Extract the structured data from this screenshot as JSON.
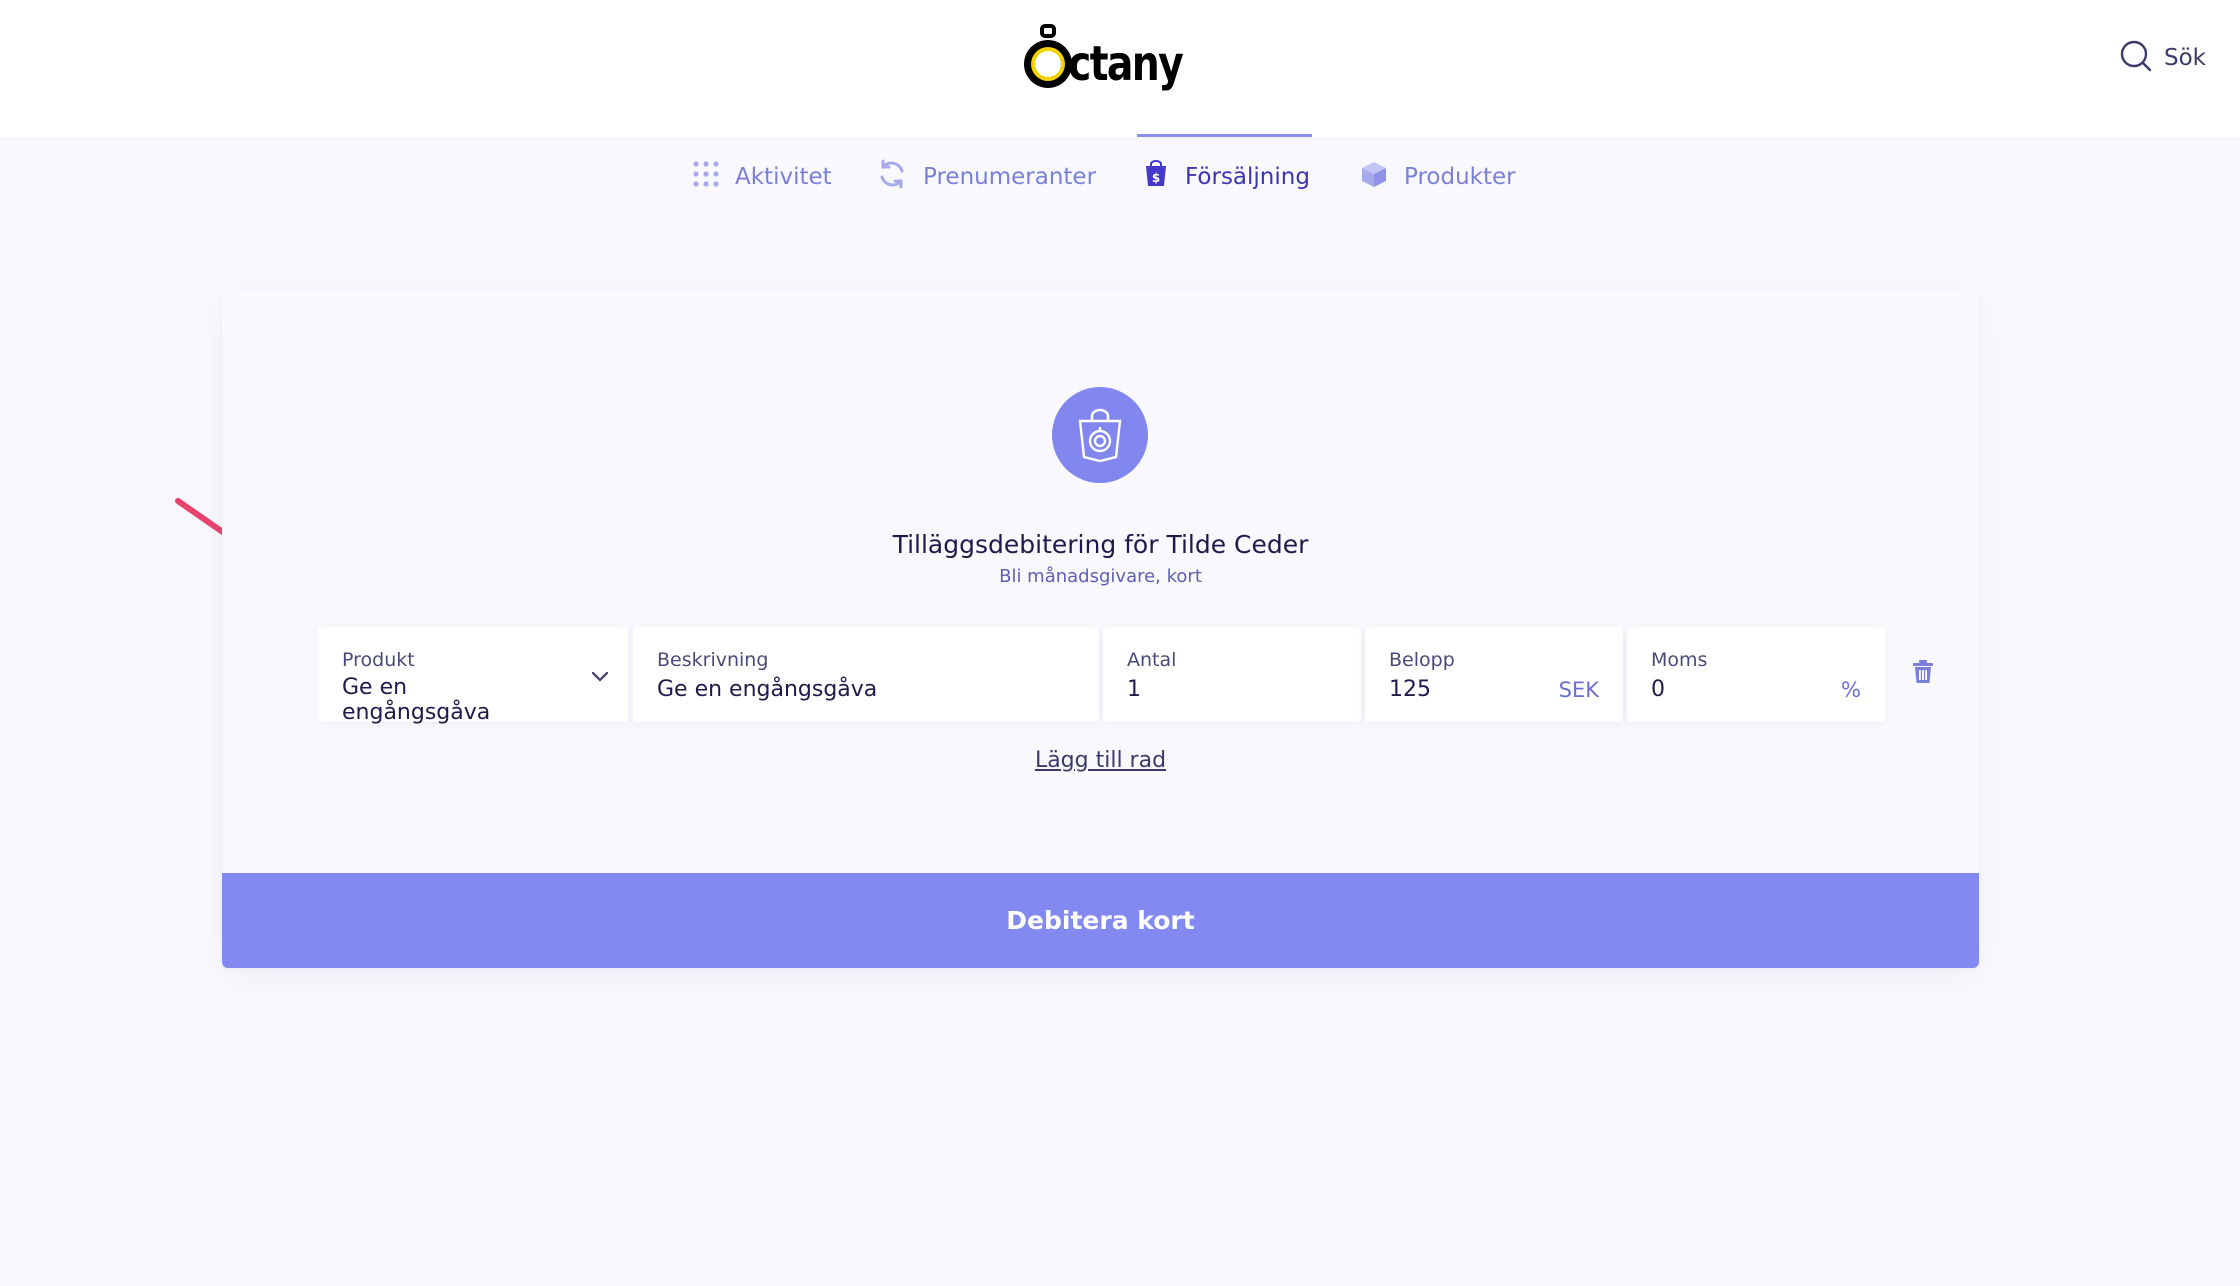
{
  "header": {
    "logo_text": "ctany",
    "search_label": "Sök"
  },
  "nav": {
    "items": [
      {
        "label": "Aktivitet",
        "icon": "grid-dots-icon",
        "active": false
      },
      {
        "label": "Prenumeranter",
        "icon": "refresh-icon",
        "active": false
      },
      {
        "label": "Försäljning",
        "icon": "shopping-bag-icon",
        "active": true
      },
      {
        "label": "Produkter",
        "icon": "box-icon",
        "active": false
      }
    ]
  },
  "card": {
    "icon": "shopping-bag-icon",
    "title": "Tilläggsdebitering för Tilde Ceder",
    "subtitle": "Bli månadsgivare, kort",
    "fields": {
      "product": {
        "label": "Produkt",
        "value": "Ge en engångsgåva"
      },
      "description": {
        "label": "Beskrivning",
        "value": "Ge en engångsgåva"
      },
      "quantity": {
        "label": "Antal",
        "value": "1"
      },
      "amount": {
        "label": "Belopp",
        "value": "125",
        "unit": "SEK"
      },
      "vat": {
        "label": "Moms",
        "value": "0",
        "unit": "%"
      }
    },
    "add_row_label": "Lägg till rad",
    "submit_label": "Debitera kort"
  },
  "colors": {
    "accent": "#8289f1",
    "nav_text": "#7a7fd9",
    "nav_active": "#3b35b0",
    "arrow": "#e8436c"
  }
}
